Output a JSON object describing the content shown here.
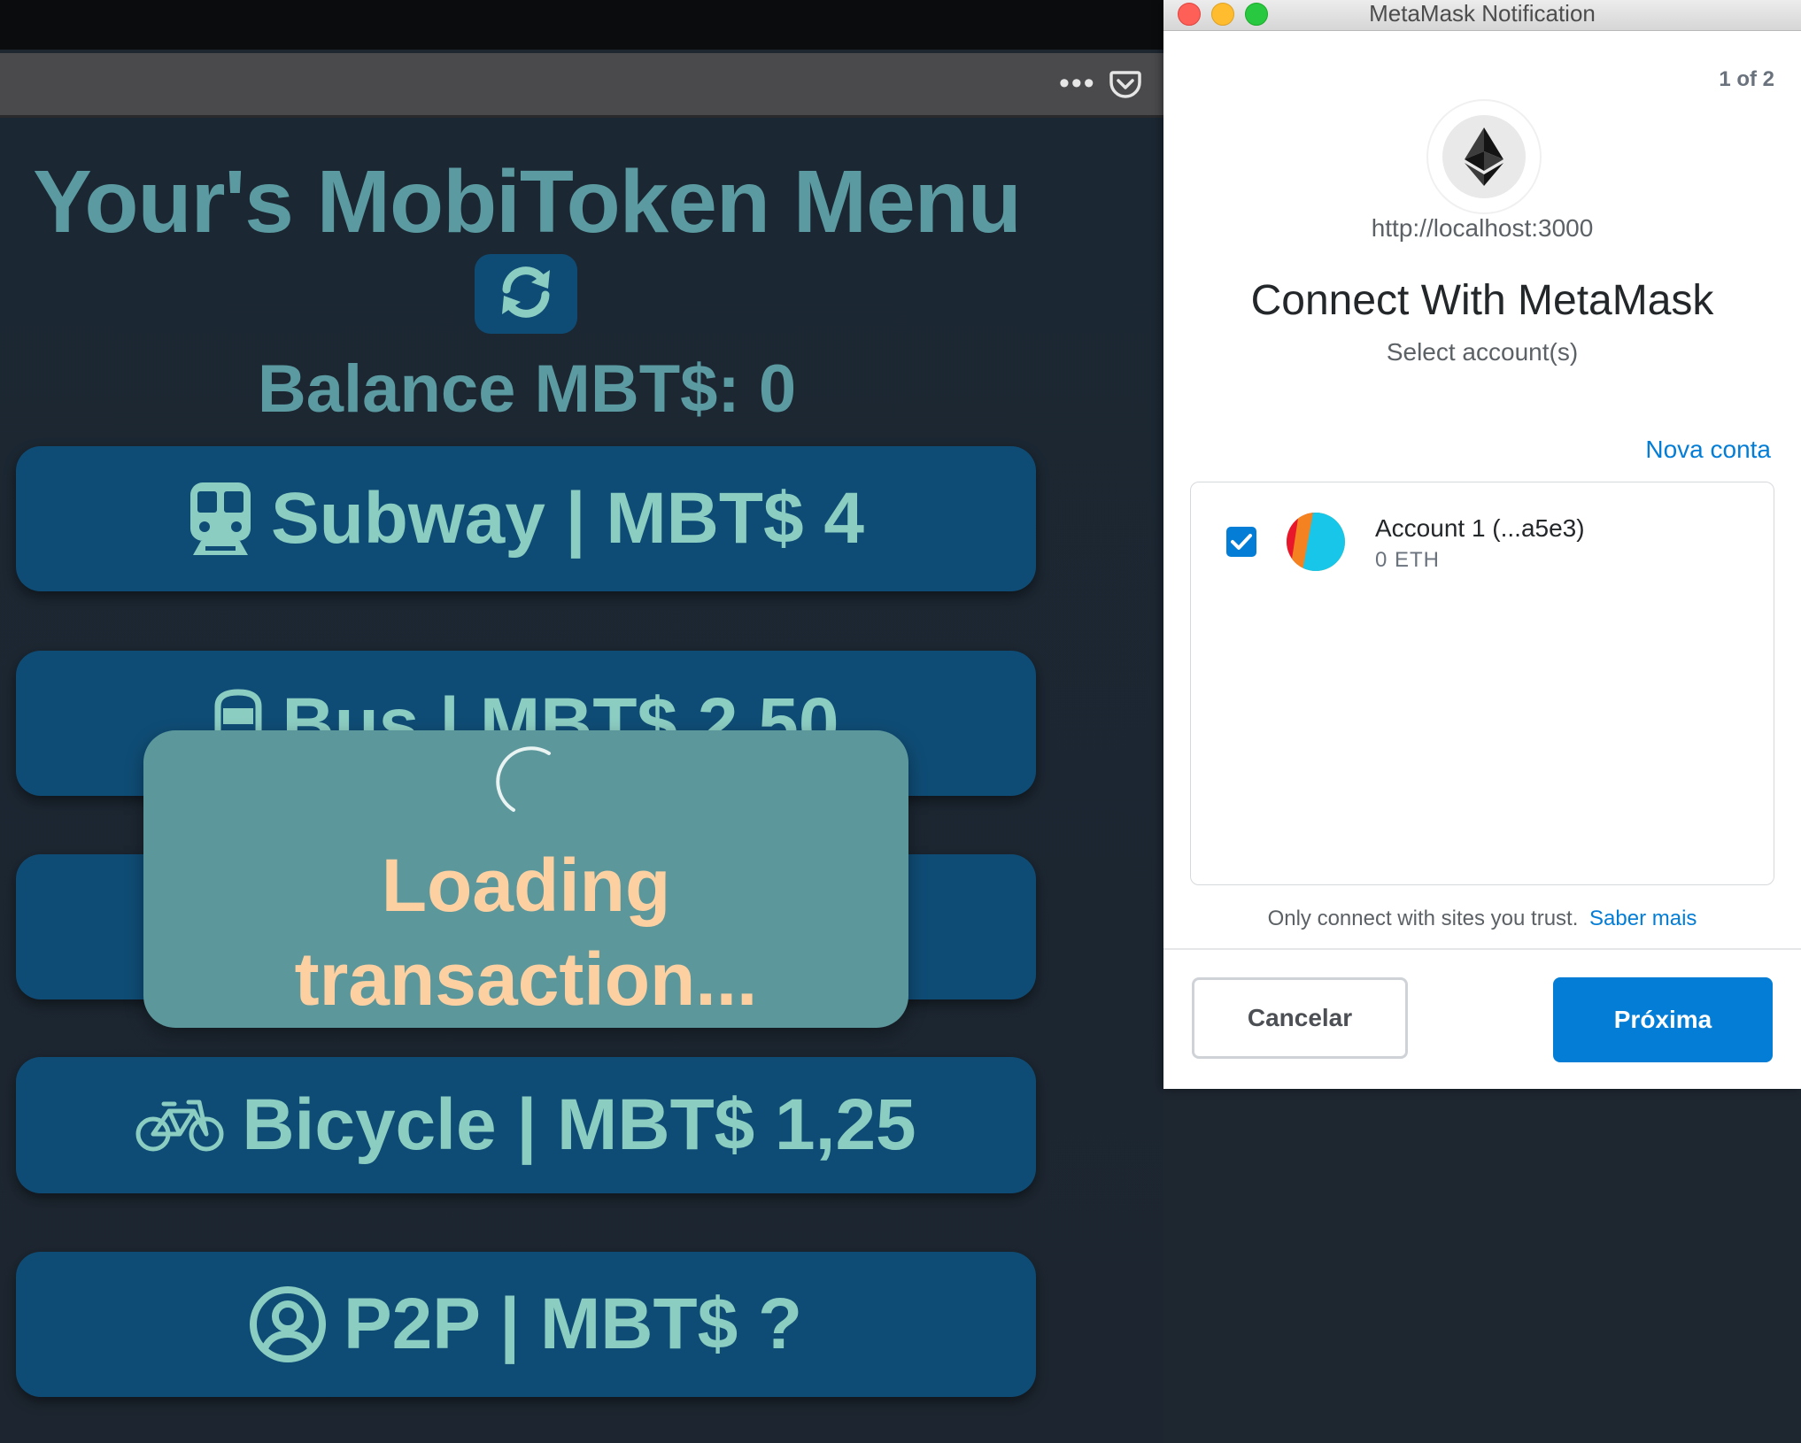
{
  "browser": {
    "more_icon": "more-horizontal-icon",
    "pocket_icon": "pocket-icon"
  },
  "app": {
    "title": "Your's MobiToken Menu",
    "refresh_icon": "sync-icon",
    "balance": "Balance MBT$: 0",
    "menu": [
      {
        "label": "Subway | MBT$ 4",
        "icon": "subway-icon"
      },
      {
        "label": "Bus | MBT$ 2,50",
        "icon": "bus-icon"
      },
      {
        "label": "",
        "icon": ""
      },
      {
        "label": "Bicycle | MBT$ 1,25",
        "icon": "bicycle-icon"
      },
      {
        "label": "P2P | MBT$ ?",
        "icon": "user-circle-icon"
      }
    ],
    "loading": {
      "text_line1": "Loading",
      "text_line2": "transaction..."
    }
  },
  "metamask": {
    "window_title": "MetaMask Notification",
    "page_count": "1 of 2",
    "origin": "http://localhost:3000",
    "heading": "Connect With MetaMask",
    "subheading": "Select account(s)",
    "new_account_link": "Nova conta",
    "accounts": [
      {
        "name": "Account 1 (...a5e3)",
        "balance": "0 ETH",
        "checked": true
      }
    ],
    "trust_text": "Only connect with sites you trust.",
    "learn_more": "Saber mais",
    "cancel_label": "Cancelar",
    "next_label": "Próxima",
    "accent": "#037dd6"
  }
}
